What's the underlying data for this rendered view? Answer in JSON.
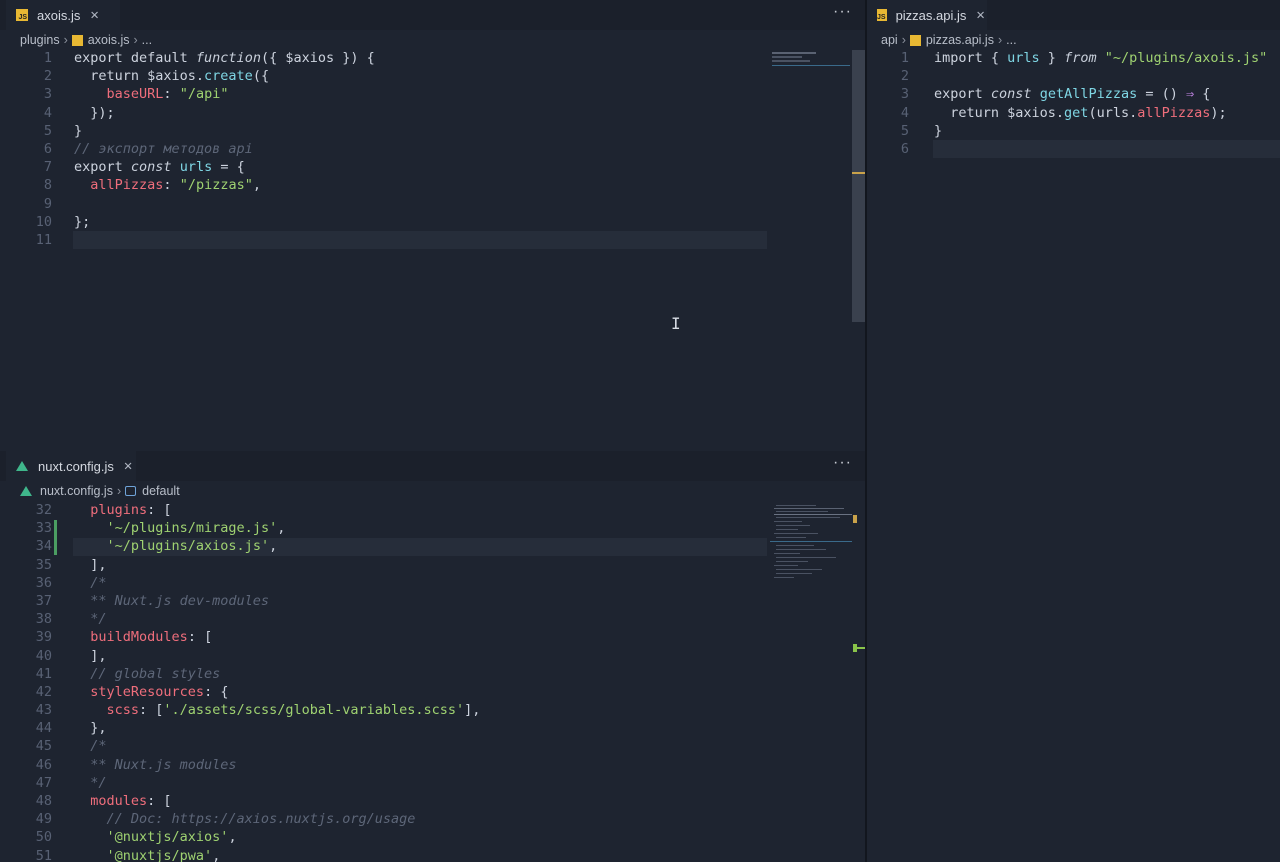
{
  "left_top": {
    "tab": {
      "name": "axois.js",
      "close": "✕"
    },
    "more": "···",
    "breadcrumb": {
      "folder": "plugins",
      "file": "axois.js",
      "tail": "..."
    },
    "lines": [
      "1",
      "2",
      "3",
      "4",
      "5",
      "6",
      "7",
      "8",
      "9",
      "10",
      "11"
    ],
    "code": [
      "export default function({ $axios }) {",
      "  return $axios.create({",
      "    baseURL: \"/api\"",
      "  });",
      "}",
      "// экспорт методов api",
      "export const urls = {",
      "  allPizzas: \"/pizzas\",",
      "",
      "};",
      ""
    ]
  },
  "right_top": {
    "tab": {
      "name": "pizzas.api.js",
      "close": "✕"
    },
    "breadcrumb": {
      "folder": "api",
      "file": "pizzas.api.js",
      "tail": "..."
    },
    "lines": [
      "1",
      "2",
      "3",
      "4",
      "5",
      "6"
    ],
    "code": [
      "import { urls } from \"~/plugins/axois.js\"",
      "",
      "export const getAllPizzas = () ⇒ {",
      "  return $axios.get(urls.allPizzas);",
      "}",
      ""
    ]
  },
  "bottom": {
    "tab": {
      "name": "nuxt.config.js",
      "close": "✕"
    },
    "more": "···",
    "breadcrumb": {
      "file": "nuxt.config.js",
      "symbol": "default"
    },
    "lines": [
      "32",
      "33",
      "34",
      "35",
      "36",
      "37",
      "38",
      "39",
      "40",
      "41",
      "42",
      "43",
      "44",
      "45",
      "46",
      "47",
      "48",
      "49",
      "50",
      "51"
    ],
    "code": [
      "  plugins: [",
      "    '~/plugins/mirage.js',",
      "    '~/plugins/axios.js',",
      "  ],",
      "  /*",
      "  ** Nuxt.js dev-modules",
      "  */",
      "  buildModules: [",
      "  ],",
      "  // global styles",
      "  styleResources: {",
      "    scss: ['./assets/scss/global-variables.scss'],",
      "  },",
      "  /*",
      "  ** Nuxt.js modules",
      "  */",
      "  modules: [",
      "    // Doc: https://axios.nuxtjs.org/usage",
      "    '@nuxtjs/axios',",
      "    '@nuxtjs/pwa',"
    ]
  },
  "colors": {
    "keyword": "#c8cfda",
    "function": "#7fd6e4",
    "string": "#9fd271",
    "property": "#ef6e7c",
    "comment": "#5d6678"
  }
}
